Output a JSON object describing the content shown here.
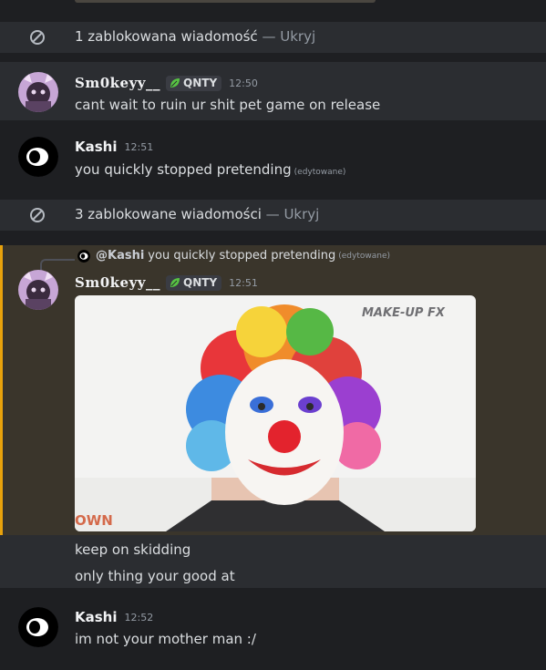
{
  "blocked_notices": [
    {
      "text": "1 zablokowana wiadomość",
      "separator": " — ",
      "action": "Ukryj"
    },
    {
      "text": "3 zablokowane wiadomości",
      "separator": " — ",
      "action": "Ukryj"
    }
  ],
  "messages": [
    {
      "author": "Sm0keyy__",
      "tag": "QNTY",
      "time": "12:50",
      "text": "cant wait to ruin ur shit pet game on release"
    },
    {
      "author": "Kashi",
      "time": "12:51",
      "text": "you quickly stopped pretending",
      "edited": "(edytowane)"
    },
    {
      "author": "Sm0keyy__",
      "tag": "QNTY",
      "time": "12:51",
      "reply": {
        "author": "@Kashi",
        "text": "you quickly stopped pretending",
        "edited": "(edytowane)"
      },
      "image": {
        "watermark": "MAKE-UP FX",
        "corner_text": "OWN"
      }
    },
    {
      "text": "keep on skidding"
    },
    {
      "text": "only thing your good at"
    },
    {
      "author": "Kashi",
      "time": "12:52",
      "text": "im not your mother man :/"
    }
  ],
  "colors": {
    "highlight_bar": "#e8a20c",
    "highlight_bg": "#3a352b",
    "tag_leaf": "#57c443"
  }
}
